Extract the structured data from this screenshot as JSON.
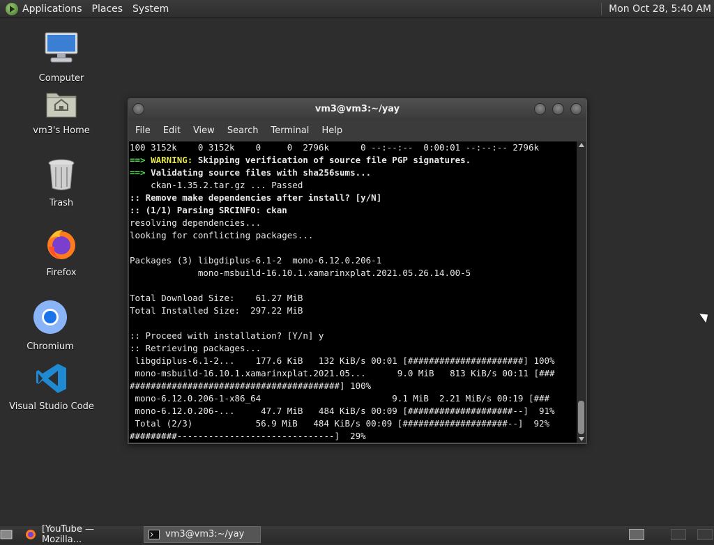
{
  "top_panel": {
    "menus": [
      "Applications",
      "Places",
      "System"
    ],
    "clock": "Mon Oct 28,  5:40 AM"
  },
  "desktop_icons": [
    {
      "label": "Computer",
      "icon": "computer-icon"
    },
    {
      "label": "vm3's Home",
      "icon": "home-folder-icon"
    },
    {
      "label": "Trash",
      "icon": "trash-icon"
    },
    {
      "label": "Firefox",
      "icon": "firefox-icon"
    },
    {
      "label": "Chromium",
      "icon": "chromium-icon"
    },
    {
      "label": "Visual Studio Code",
      "icon": "vscode-icon"
    }
  ],
  "terminal": {
    "title": "vm3@vm3:~/yay",
    "menu": [
      "File",
      "Edit",
      "View",
      "Search",
      "Terminal",
      "Help"
    ],
    "lines": [
      "100 3152k    0 3152k    0     0  2796k      0 --:--:--  0:00:01 --:--:-- 2796k",
      "==> WARNING: Skipping verification of source file PGP signatures.",
      "==> Validating source files with sha256sums...",
      "    ckan-1.35.2.tar.gz ... Passed",
      ":: Remove make dependencies after install? [y/N]",
      ":: (1/1) Parsing SRCINFO: ckan",
      "resolving dependencies...",
      "looking for conflicting packages...",
      "",
      "Packages (3) libgdiplus-6.1-2  mono-6.12.0.206-1",
      "             mono-msbuild-16.10.1.xamarinxplat.2021.05.26.14.00-5",
      "",
      "Total Download Size:    61.27 MiB",
      "Total Installed Size:  297.22 MiB",
      "",
      ":: Proceed with installation? [Y/n] y",
      ":: Retrieving packages...",
      " libgdiplus-6.1-2...    177.6 KiB   132 KiB/s 00:01 [######################] 100%",
      " mono-msbuild-16.10.1.xamarinxplat.2021.05...      9.0 MiB   813 KiB/s 00:11 [###",
      "########################################] 100%",
      " mono-6.12.0.206-1-x86_64                         9.1 MiB  2.21 MiB/s 00:19 [###",
      " mono-6.12.0.206-...     47.7 MiB   484 KiB/s 00:09 [####################--]  91%",
      " Total (2/3)            56.9 MiB   484 KiB/s 00:09 [####################--]  92%",
      "#########------------------------------]  29%"
    ]
  },
  "taskbar": {
    "tasks": [
      {
        "label": "[YouTube — Mozilla...",
        "icon": "firefox-icon",
        "active": false
      },
      {
        "label": "vm3@vm3:~/yay",
        "icon": "terminal-icon",
        "active": true
      }
    ]
  }
}
